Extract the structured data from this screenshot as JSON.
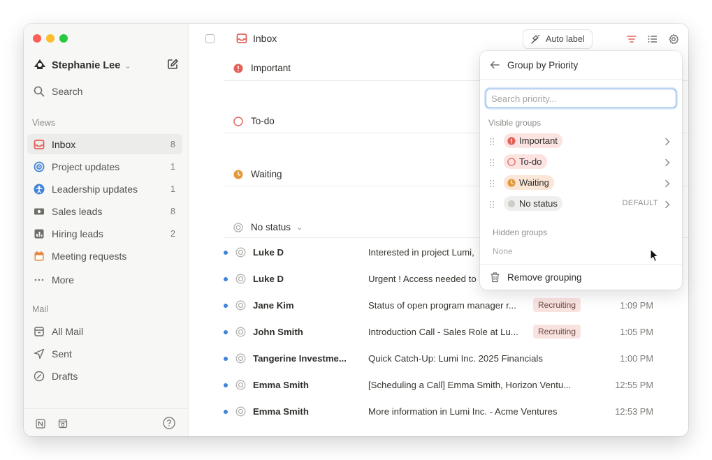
{
  "sidebar": {
    "user_name": "Stephanie Lee",
    "search_label": "Search",
    "views_heading": "Views",
    "views": [
      {
        "label": "Inbox",
        "count": "8",
        "icon": "inbox-icon",
        "color": "#e16259"
      },
      {
        "label": "Project updates",
        "count": "1",
        "icon": "target-icon",
        "color": "#3f84d8"
      },
      {
        "label": "Leadership updates",
        "count": "1",
        "icon": "person-icon",
        "color": "#3f84d8"
      },
      {
        "label": "Sales leads",
        "count": "8",
        "icon": "money-icon",
        "color": "#5a5954"
      },
      {
        "label": "Hiring leads",
        "count": "2",
        "icon": "chart-icon",
        "color": "#5a5954"
      },
      {
        "label": "Meeting requests",
        "count": "",
        "icon": "calendar-icon",
        "color": "#e9833b"
      },
      {
        "label": "More",
        "count": "",
        "icon": "ellipsis-icon",
        "color": "#7d7b77"
      }
    ],
    "mail_heading": "Mail",
    "mail": [
      {
        "label": "All Mail",
        "icon": "archive-icon"
      },
      {
        "label": "Sent",
        "icon": "send-icon"
      },
      {
        "label": "Drafts",
        "icon": "draft-icon"
      }
    ]
  },
  "header": {
    "title": "Inbox",
    "auto_label": "Auto label"
  },
  "groups": [
    {
      "label": "Important",
      "icon": "important-icon"
    },
    {
      "label": "To-do",
      "icon": "todo-icon"
    },
    {
      "label": "Waiting",
      "icon": "waiting-icon"
    },
    {
      "label": "No status",
      "icon": "no-status-icon"
    }
  ],
  "emails": [
    {
      "sender": "Luke D",
      "subject": "Interested in project Lumi,",
      "tag": "",
      "time": ""
    },
    {
      "sender": "Luke D",
      "subject": "Urgent ! Access needed to",
      "tag": "",
      "time": ""
    },
    {
      "sender": "Jane Kim",
      "subject": "Status of open program manager r...",
      "tag": "Recruiting",
      "time": "1:09 PM"
    },
    {
      "sender": "John Smith",
      "subject": "Introduction Call - Sales Role at Lu...",
      "tag": "Recruiting",
      "time": "1:05 PM"
    },
    {
      "sender": "Tangerine Investme...",
      "subject": "Quick Catch-Up: Lumi Inc. 2025 Financials",
      "tag": "",
      "time": "1:00 PM"
    },
    {
      "sender": "Emma Smith",
      "subject": "[Scheduling a Call] Emma Smith, Horizon Ventu...",
      "tag": "",
      "time": "12:55 PM"
    },
    {
      "sender": "Emma Smith",
      "subject": "More information in Lumi Inc. - Acme Ventures",
      "tag": "",
      "time": "12:53 PM"
    }
  ],
  "popover": {
    "title": "Group by Priority",
    "search_placeholder": "Search priority...",
    "visible_heading": "Visible groups",
    "visible": [
      {
        "label": "Important",
        "pill_color": "#fbe3e1",
        "default": ""
      },
      {
        "label": "To-do",
        "pill_color": "#fbe3e1",
        "default": ""
      },
      {
        "label": "Waiting",
        "pill_color": "#fbe6d8",
        "default": ""
      },
      {
        "label": "No status",
        "pill_color": "#efefed",
        "default": "DEFAULT"
      }
    ],
    "hidden_heading": "Hidden groups",
    "hidden_none": "None",
    "remove_label": "Remove grouping"
  },
  "colors": {
    "accent": "#e16259",
    "orange": "#e9833b",
    "blue_dot": "#3f84d8"
  }
}
